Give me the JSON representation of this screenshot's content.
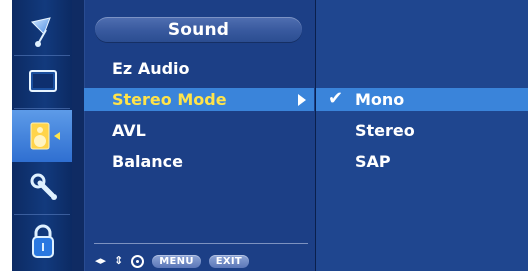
{
  "menu": {
    "title": "Sound",
    "items": [
      {
        "label": "Ez Audio"
      },
      {
        "label": "Stereo Mode"
      },
      {
        "label": "AVL"
      },
      {
        "label": "Balance"
      }
    ],
    "selected_index": 1
  },
  "submenu": {
    "items": [
      {
        "label": "Mono",
        "checked": true
      },
      {
        "label": "Stereo"
      },
      {
        "label": "SAP"
      }
    ],
    "check_glyph": "✔"
  },
  "footer": {
    "nav_lr": "◂▸",
    "nav_ud": "⇕",
    "menu_label": "MENU",
    "exit_label": "EXIT"
  },
  "left_icons": [
    {
      "name": "satellite-icon"
    },
    {
      "name": "screen-icon"
    },
    {
      "name": "sound-speaker-icon",
      "selected": true
    },
    {
      "name": "tools-icon"
    },
    {
      "name": "lock-icon"
    }
  ],
  "colors": {
    "highlight": "#3a84da",
    "selected_text": "#ffe44a"
  }
}
